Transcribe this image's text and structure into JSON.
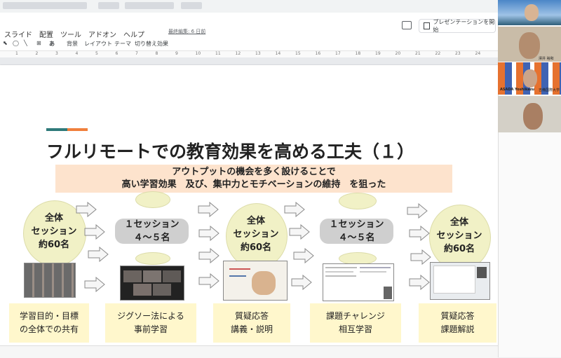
{
  "menu": {
    "items": [
      "スライド",
      "配置",
      "ツール",
      "アドオン",
      "ヘルプ"
    ],
    "last_edit": "最終編集: 6 日前",
    "present_label": "プレゼンテーションを開始"
  },
  "toolbar": {
    "font_label": "あ",
    "bg_label": "背景",
    "layout_label": "レイアウト",
    "theme_label": "テーマ",
    "transition_label": "切り替え効果"
  },
  "ruler": [
    "1",
    "2",
    "3",
    "4",
    "5",
    "6",
    "7",
    "8",
    "9",
    "10",
    "11",
    "12",
    "13",
    "14",
    "15",
    "16",
    "17",
    "18",
    "19",
    "20",
    "21",
    "22",
    "23",
    "24"
  ],
  "slide": {
    "title": "フルリモートでの教育効果を高める工夫（１）",
    "banner_line1": "アウトプットの機会を多く設けることで",
    "banner_line2": "高い学習効果　及び、集中力とモチベーションの維持　を狙った",
    "stages": [
      {
        "kind": "full",
        "text": "全体\nセッション\n約60名",
        "caption": "学習目的・目標\nの全体での共有"
      },
      {
        "kind": "group",
        "text": "１セッション\n４～５名",
        "caption": "ジグソー法による\n事前学習"
      },
      {
        "kind": "full",
        "text": "全体\nセッション\n約60名",
        "caption": "質疑応答\n講義・説明"
      },
      {
        "kind": "group",
        "text": "１セッション\n４～５名",
        "caption": "課題チャレンジ\n相互学習"
      },
      {
        "kind": "full",
        "text": "全体\nセッション\n約60名",
        "caption": "質疑応答\n課題解説"
      }
    ]
  },
  "video": {
    "tile3_name": "ASADA Yoshikazu",
    "tile3_org": "吉備国際大学",
    "tile2_name": "澤井 裕和"
  }
}
